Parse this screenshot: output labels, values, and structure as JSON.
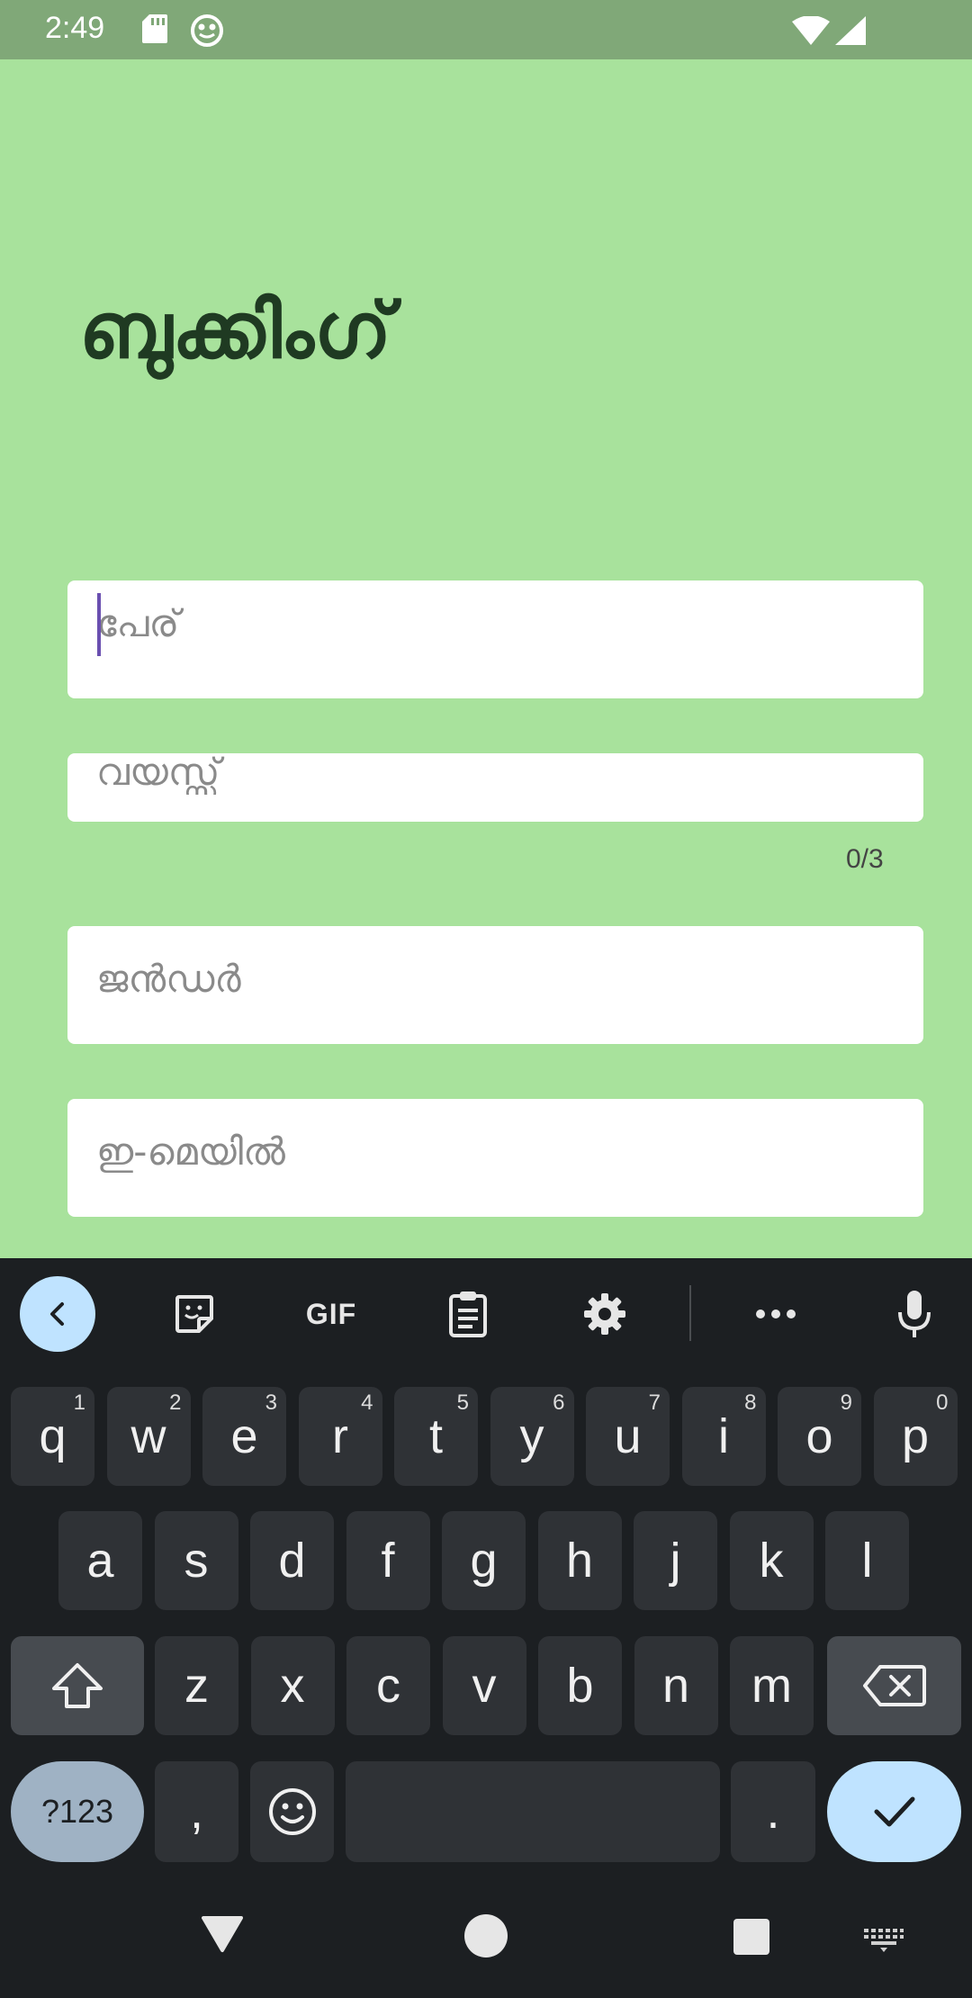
{
  "status_bar": {
    "time": "2:49",
    "icons": [
      "sd-card-icon",
      "frog-icon",
      "wifi-icon",
      "signal-icon"
    ]
  },
  "form": {
    "title": "ബുക്കിംഗ്",
    "name": {
      "placeholder": "പേര്",
      "value": ""
    },
    "age": {
      "placeholder": "വയസ്സ്",
      "value": "",
      "counter": "0/3"
    },
    "gender": {
      "placeholder": "ജൻഡർ",
      "value": ""
    },
    "email": {
      "placeholder": "ഇ-മെയിൽ",
      "value": ""
    }
  },
  "keyboard": {
    "toolbar": {
      "gif_label": "GIF",
      "icons": [
        "back-icon",
        "sticker-icon",
        "gif-icon",
        "clipboard-icon",
        "settings-icon",
        "more-icon",
        "mic-icon"
      ]
    },
    "row1": [
      {
        "key": "q",
        "sup": "1"
      },
      {
        "key": "w",
        "sup": "2"
      },
      {
        "key": "e",
        "sup": "3"
      },
      {
        "key": "r",
        "sup": "4"
      },
      {
        "key": "t",
        "sup": "5"
      },
      {
        "key": "y",
        "sup": "6"
      },
      {
        "key": "u",
        "sup": "7"
      },
      {
        "key": "i",
        "sup": "8"
      },
      {
        "key": "o",
        "sup": "9"
      },
      {
        "key": "p",
        "sup": "0"
      }
    ],
    "row2": [
      "a",
      "s",
      "d",
      "f",
      "g",
      "h",
      "j",
      "k",
      "l"
    ],
    "row3": [
      "z",
      "x",
      "c",
      "v",
      "b",
      "n",
      "m"
    ],
    "mode_label": "?123",
    "comma_label": ",",
    "period_label": "."
  },
  "colors": {
    "background": "#a8e29c",
    "status_bar": "#80a878",
    "title": "#1f3a22",
    "caret": "#6a4fb0",
    "keyboard_bg": "#1c1f22",
    "key_bg": "#2f3236",
    "accent_key": "#bfe3ff"
  }
}
